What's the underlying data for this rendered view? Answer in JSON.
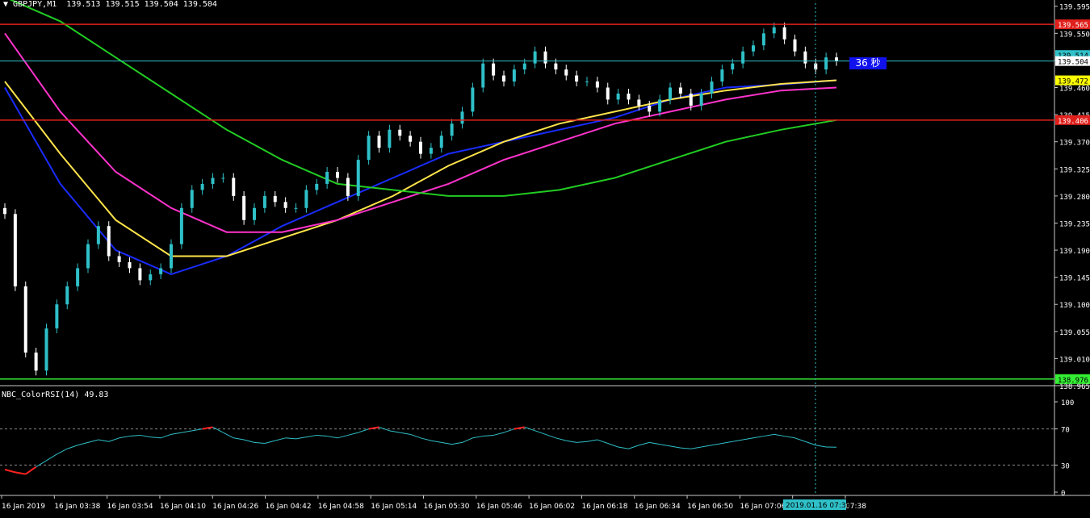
{
  "title": "GBPJPY,M1",
  "quote": "139.513 139.515 139.504 139.504",
  "timer_label": "36 秒",
  "rsi_title": "NBC_ColorRSI(14) 49.83",
  "price_ticks": [
    "139.595",
    "139.550",
    "139.505",
    "139.460",
    "139.415",
    "139.370",
    "139.325",
    "139.280",
    "139.235",
    "139.190",
    "139.145",
    "139.100",
    "139.055",
    "139.010",
    "138.965"
  ],
  "price_labels": [
    {
      "text": "139.565",
      "value": 139.565,
      "color": "#e0201c"
    },
    {
      "text": "139.514",
      "value": 139.514,
      "color": "#2fc0c8"
    },
    {
      "text": "139.504",
      "value": 139.504,
      "color": "#ffffff"
    },
    {
      "text": "139.472",
      "value": 139.472,
      "color": "#ffff00"
    },
    {
      "text": "139.406",
      "value": 139.406,
      "color": "#e0201c"
    },
    {
      "text": "138.976",
      "value": 138.976,
      "color": "#33ee33"
    }
  ],
  "rsi_ticks": [
    "100",
    "70",
    "30",
    "0"
  ],
  "time_ticks": [
    "16 Jan 2019",
    "16 Jan 03:38",
    "16 Jan 03:54",
    "16 Jan 04:10",
    "16 Jan 04:26",
    "16 Jan 04:42",
    "16 Jan 04:58",
    "16 Jan 05:14",
    "16 Jan 05:30",
    "16 Jan 05:46",
    "16 Jan 06:02",
    "16 Jan 06:18",
    "16 Jan 06:34",
    "16 Jan 06:50",
    "16 Jan 07:06",
    "16",
    "07:38"
  ],
  "crosshair_label": "2019.01.16 07:35",
  "colors": {
    "bull": "#2fc0c8",
    "bear": "#ffffff",
    "ma_fast": "#1a2cff",
    "ma_mid": "#ffe44a",
    "ma_slow": "#ff33cc",
    "ma_long": "#22cc22",
    "rsi": "#2fc0c8",
    "rsi_hot": "#ff2222"
  },
  "chart_data": [
    {
      "type": "candlestick",
      "symbol": "GBPJPY",
      "timeframe": "M1",
      "ylim": [
        138.965,
        139.6
      ],
      "x_labels": [
        "16 Jan 2019",
        "16 Jan 03:38",
        "16 Jan 03:54",
        "16 Jan 04:10",
        "16 Jan 04:26",
        "16 Jan 04:42",
        "16 Jan 04:58",
        "16 Jan 05:14",
        "16 Jan 05:30",
        "16 Jan 05:46",
        "16 Jan 06:02",
        "16 Jan 06:18",
        "16 Jan 06:34",
        "16 Jan 06:50",
        "16 Jan 07:06",
        "07:38"
      ],
      "last": {
        "open": 139.513,
        "high": 139.515,
        "low": 139.504,
        "close": 139.504
      },
      "horizontal_levels": [
        139.565,
        139.406,
        138.976
      ],
      "path_close": [
        139.25,
        139.13,
        139.02,
        138.99,
        139.06,
        139.1,
        139.13,
        139.16,
        139.2,
        139.23,
        139.18,
        139.17,
        139.16,
        139.14,
        139.15,
        139.16,
        139.2,
        139.26,
        139.29,
        139.3,
        139.31,
        139.31,
        139.28,
        139.24,
        139.26,
        139.28,
        139.27,
        139.26,
        139.26,
        139.29,
        139.3,
        139.32,
        139.31,
        139.28,
        139.34,
        139.38,
        139.36,
        139.39,
        139.38,
        139.37,
        139.35,
        139.36,
        139.38,
        139.4,
        139.42,
        139.46,
        139.5,
        139.48,
        139.47,
        139.49,
        139.5,
        139.52,
        139.5,
        139.49,
        139.48,
        139.47,
        139.47,
        139.46,
        139.44,
        139.45,
        139.44,
        139.43,
        139.42,
        139.44,
        139.46,
        139.45,
        139.43,
        139.45,
        139.47,
        139.49,
        139.5,
        139.52,
        139.53,
        139.55,
        139.56,
        139.54,
        139.52,
        139.5,
        139.49,
        139.51,
        139.504
      ],
      "moving_averages": [
        {
          "color": "blue",
          "values": [
            139.46,
            139.3,
            139.19,
            139.15,
            139.18,
            139.23,
            139.27,
            139.31,
            139.35,
            139.37,
            139.39,
            139.41,
            139.44,
            139.46,
            139.465,
            139.472
          ]
        },
        {
          "color": "yellow",
          "values": [
            139.47,
            139.35,
            139.24,
            139.18,
            139.18,
            139.21,
            139.24,
            139.28,
            139.33,
            139.37,
            139.4,
            139.42,
            139.44,
            139.455,
            139.466,
            139.472
          ]
        },
        {
          "color": "magenta",
          "values": [
            139.55,
            139.42,
            139.32,
            139.26,
            139.22,
            139.22,
            139.24,
            139.27,
            139.3,
            139.34,
            139.37,
            139.4,
            139.42,
            139.44,
            139.455,
            139.46
          ]
        },
        {
          "color": "green",
          "values": [
            139.61,
            139.57,
            139.51,
            139.45,
            139.39,
            139.34,
            139.3,
            139.29,
            139.28,
            139.28,
            139.29,
            139.31,
            139.34,
            139.37,
            139.39,
            139.406
          ]
        }
      ]
    },
    {
      "type": "line",
      "name": "NBC_ColorRSI(14)",
      "ylim": [
        0,
        100
      ],
      "levels": [
        70,
        30
      ],
      "last_value": 49.83,
      "values": [
        25,
        22,
        20,
        28,
        35,
        42,
        48,
        52,
        55,
        58,
        56,
        60,
        62,
        63,
        61,
        60,
        64,
        66,
        68,
        70,
        72,
        66,
        60,
        58,
        55,
        54,
        57,
        60,
        59,
        61,
        63,
        62,
        60,
        63,
        66,
        70,
        72,
        68,
        66,
        64,
        60,
        57,
        55,
        53,
        55,
        60,
        62,
        63,
        66,
        70,
        72,
        68,
        64,
        60,
        57,
        55,
        56,
        58,
        54,
        50,
        48,
        52,
        55,
        53,
        51,
        49,
        48,
        50,
        52,
        54,
        56,
        58,
        60,
        62,
        64,
        62,
        60,
        56,
        52,
        50,
        49.83
      ]
    }
  ]
}
